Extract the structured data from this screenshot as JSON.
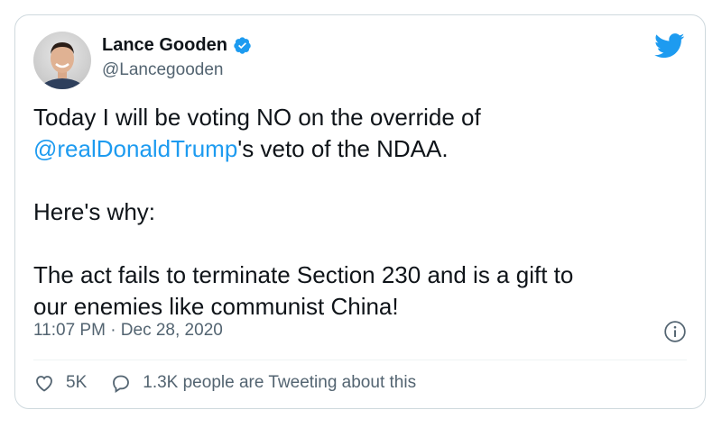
{
  "author": {
    "display_name": "Lance Gooden",
    "handle": "@Lancegooden",
    "verified": true,
    "avatar_icon": "avatar"
  },
  "tweet": {
    "line1": "Today I will be voting NO on the override of",
    "mention": "@realDonaldTrump",
    "line2_rest": "'s veto of the NDAA.",
    "para2": "Here's why:",
    "para3_line1": "The act fails to terminate Section 230 and is a gift to",
    "para3_line2": "our enemies like communist China!"
  },
  "meta": {
    "timestamp": "11:07 PM · Dec 28, 2020"
  },
  "actions": {
    "likes_count": "5K",
    "conversation_text": "1.3K people are Tweeting about this"
  },
  "colors": {
    "accent": "#1d9bf0",
    "text": "#0f1419",
    "secondary": "#536471",
    "border": "#cfd9de"
  }
}
